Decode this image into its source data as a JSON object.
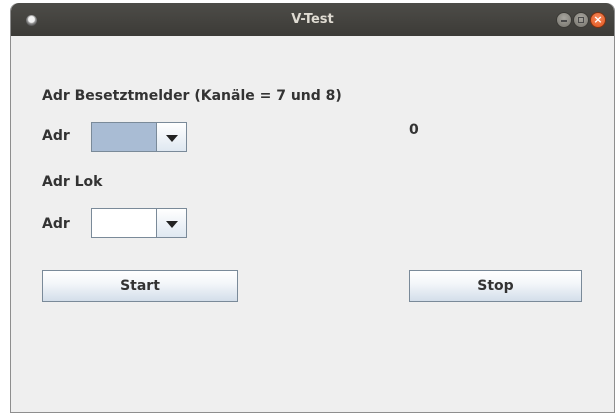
{
  "window": {
    "title": "V-Test"
  },
  "titlebar": {
    "menu_icon": "window-menu-icon",
    "minimize_icon": "minimize-icon",
    "maximize_icon": "maximize-icon",
    "close_icon": "close-icon",
    "close_glyph": "×"
  },
  "form": {
    "occupancy_heading": "Adr Besetztmelder (Kanäle = 7 und 8)",
    "occupancy_adr_label": "Adr",
    "occupancy_value": "0",
    "loco_heading": "Adr Lok",
    "loco_adr_label": "Adr"
  },
  "buttons": {
    "start_label": "Start",
    "stop_label": "Stop"
  },
  "colors": {
    "titlebar": "#3c3b37",
    "close_button": "#e0531a",
    "selected_field": "#a9bcd4",
    "window_bg": "#efefef"
  }
}
